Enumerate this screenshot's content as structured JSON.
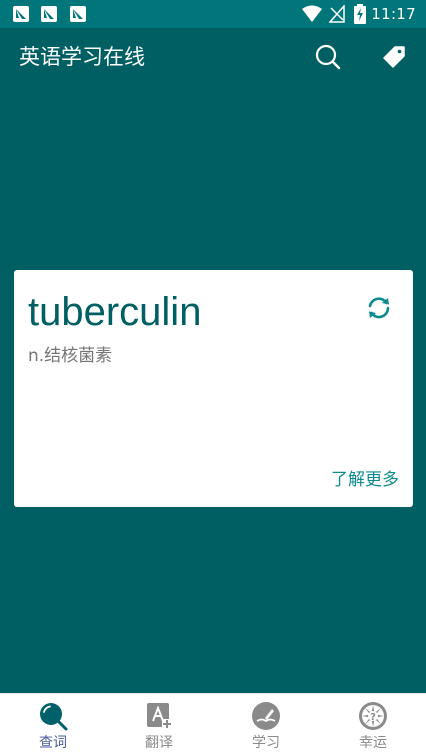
{
  "status_bar": {
    "time": "11:17",
    "notification_icons": [
      "app-notification-icon",
      "app-notification-icon",
      "app-notification-icon"
    ],
    "system_icons": [
      "wifi-icon",
      "no-signal-icon",
      "battery-charging-icon"
    ]
  },
  "app_bar": {
    "title": "英语学习在线",
    "actions": [
      "search-icon",
      "tag-icon"
    ]
  },
  "word_card": {
    "word": "tuberculin",
    "definition": "n.结核菌素",
    "more_label": "了解更多",
    "refresh_icon": "refresh-icon"
  },
  "bottom_nav": {
    "items": [
      {
        "label": "查词",
        "icon": "lookup-icon",
        "active": true
      },
      {
        "label": "翻译",
        "icon": "translate-icon",
        "active": false
      },
      {
        "label": "学习",
        "icon": "study-icon",
        "active": false
      },
      {
        "label": "幸运",
        "icon": "lucky-icon",
        "active": false
      }
    ]
  },
  "colors": {
    "primary": "#005f63",
    "status_bar": "#00767a",
    "accent_text": "#0f8a8e",
    "active_nav": "#4a5a9b",
    "inactive_nav": "#8a8a8a"
  }
}
